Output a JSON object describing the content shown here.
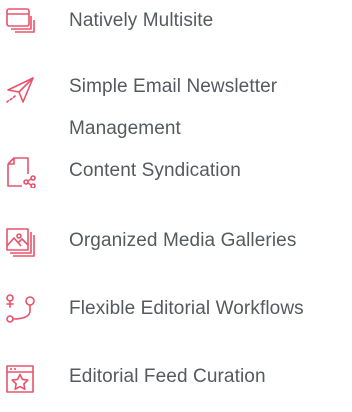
{
  "accent_color": "#e8536b",
  "features": [
    {
      "icon": "browser-windows-icon",
      "label": "Natively Multisite"
    },
    {
      "icon": "paper-plane-icon",
      "label": "Simple Email Newsletter Management"
    },
    {
      "icon": "document-share-icon",
      "label": "Content Syndication"
    },
    {
      "icon": "image-gallery-icon",
      "label": "Organized Media Galleries"
    },
    {
      "icon": "workflow-icon",
      "label": "Flexible Editorial Workflows"
    },
    {
      "icon": "star-calendar-icon",
      "label": "Editorial Feed Curation"
    }
  ]
}
